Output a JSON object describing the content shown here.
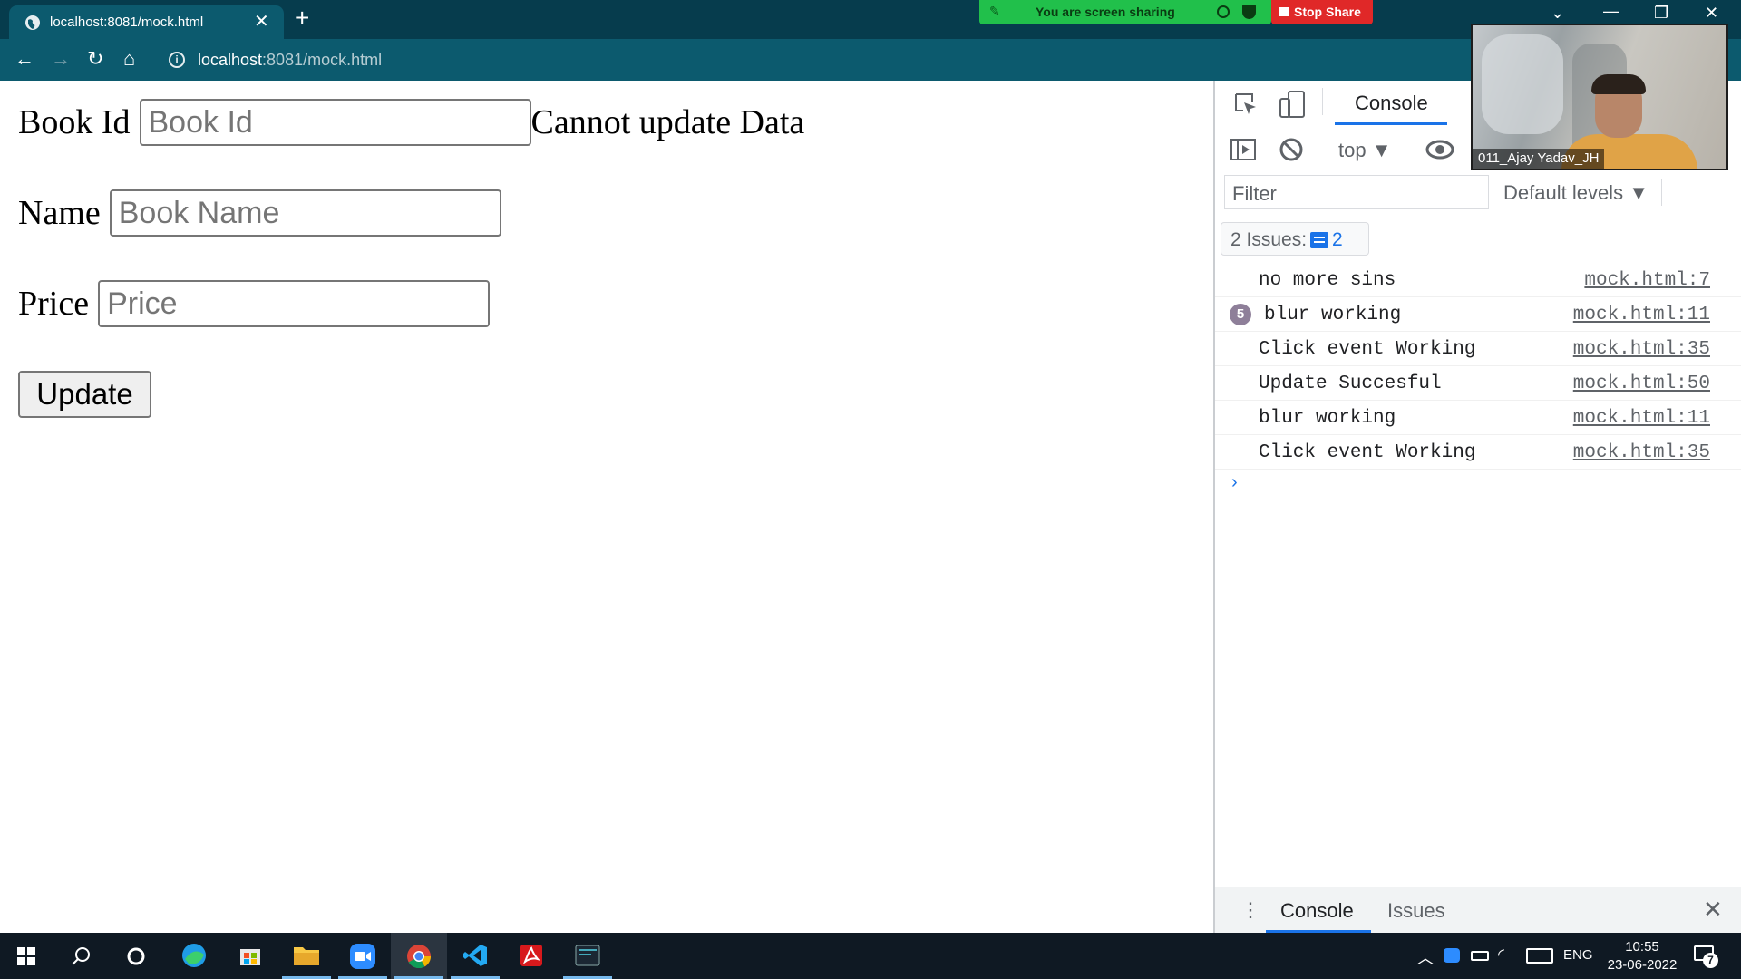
{
  "browser": {
    "tab_title": "localhost:8081/mock.html",
    "url_host": "localhost",
    "url_rest": ":8081/mock.html"
  },
  "sharing": {
    "status_text": "You are screen sharing",
    "stop_label": "Stop Share"
  },
  "page": {
    "book_id_label": "Book Id",
    "book_id_placeholder": "Book Id",
    "status_message": "Cannot update Data",
    "name_label": "Name",
    "name_placeholder": "Book Name",
    "price_label": "Price",
    "price_placeholder": "Price",
    "update_label": "Update"
  },
  "devtools": {
    "tab_console": "Console",
    "context_selector": "top",
    "filter_placeholder": "Filter",
    "levels": "Default levels",
    "issues_text": "2 Issues:",
    "issues_count": "2",
    "log": [
      {
        "message": "no more sins",
        "source": "mock.html:7"
      },
      {
        "message": "blur working",
        "source": "mock.html:11",
        "repeat": "5"
      },
      {
        "message": "Click event Working",
        "source": "mock.html:35"
      },
      {
        "message": "Update Succesful",
        "source": "mock.html:50"
      },
      {
        "message": "blur working",
        "source": "mock.html:11"
      },
      {
        "message": "Click event Working",
        "source": "mock.html:35"
      }
    ],
    "drawer_tabs": [
      "Console",
      "Issues"
    ]
  },
  "webcam": {
    "participant": "011_Ajay Yadav_JH"
  },
  "taskbar": {
    "language": "ENG",
    "time": "10:55",
    "date": "23-06-2022",
    "notifications": "7"
  }
}
